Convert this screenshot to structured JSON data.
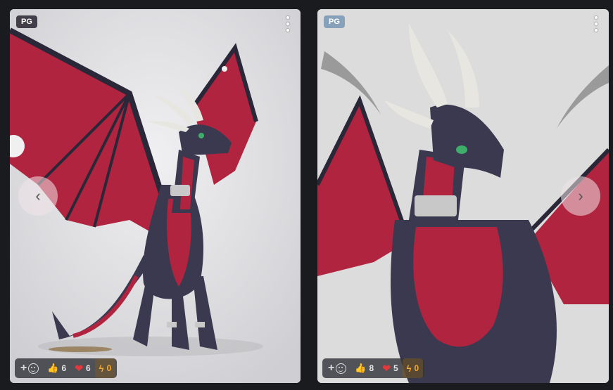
{
  "cards": [
    {
      "rating": "PG",
      "prev_label": "‹",
      "reactions": {
        "likes": "6",
        "hearts": "6",
        "tips": "0"
      }
    },
    {
      "rating": "PG",
      "next_label": "›",
      "reactions": {
        "likes": "8",
        "hearts": "5",
        "tips": "0"
      }
    }
  ],
  "icons": {
    "add": "+",
    "like": "👍",
    "heart": "❤",
    "bolt": "ϟ"
  },
  "colors": {
    "background": "#1a1b1e",
    "dragon_body": "#3a3950",
    "dragon_wing": "#b0243f",
    "horn": "#e8e6e0",
    "heart": "#e5383b",
    "bolt": "#f3a933"
  }
}
